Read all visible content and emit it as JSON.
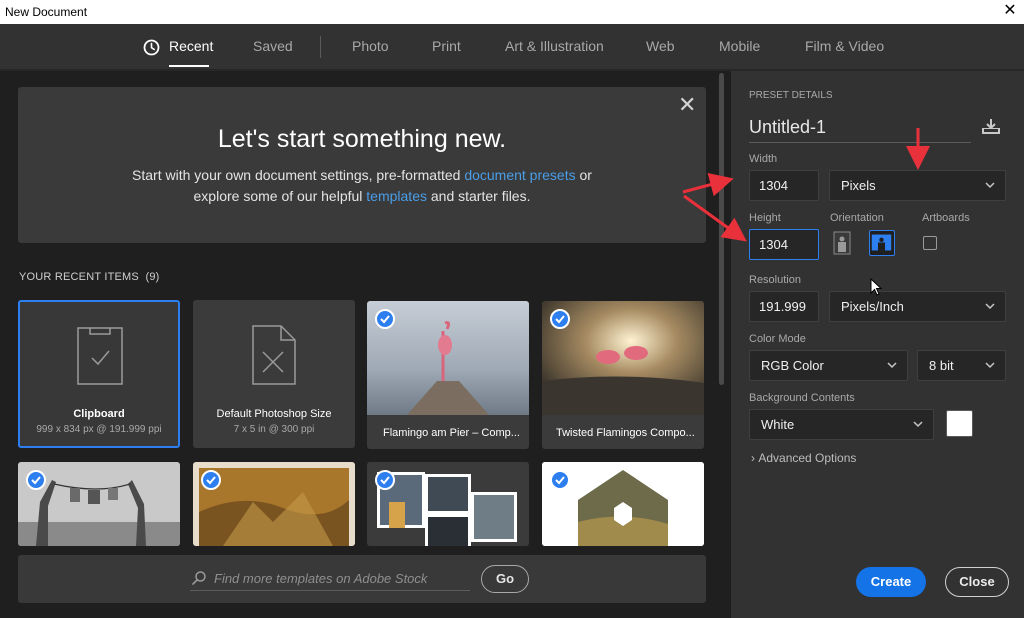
{
  "window": {
    "title": "New Document",
    "close_glyph": "✕"
  },
  "tabs": [
    {
      "label": "Recent",
      "active": true,
      "icon": "clock-icon"
    },
    {
      "label": "Saved"
    },
    {
      "label": "Photo"
    },
    {
      "label": "Print"
    },
    {
      "label": "Art & Illustration"
    },
    {
      "label": "Web"
    },
    {
      "label": "Mobile"
    },
    {
      "label": "Film & Video"
    }
  ],
  "welcome": {
    "heading": "Let's start something new.",
    "line1_pre": "Start with your own document settings, pre-formatted ",
    "line1_link": "document presets",
    "line1_post": " or",
    "line2_pre": "explore some of our helpful ",
    "line2_link": "templates",
    "line2_post": " and starter files.",
    "close_glyph": "✕"
  },
  "recent": {
    "header": "YOUR RECENT ITEMS",
    "count": "(9)",
    "items": [
      {
        "label": "Clipboard",
        "sub": "999 x 834 px @ 191.999 ppi",
        "selected": true,
        "icon": "clipboard-icon"
      },
      {
        "label": "Default Photoshop Size",
        "sub": "7 x 5 in @ 300 ppi",
        "icon": "document-ruler-icon"
      },
      {
        "label": "Flamingo am Pier – Comp...",
        "checked": true
      },
      {
        "label": "Twisted Flamingos Compo...",
        "checked": true
      },
      {
        "label": "",
        "checked": true
      },
      {
        "label": "",
        "checked": true
      },
      {
        "label": "",
        "checked": true
      },
      {
        "label": "",
        "checked": true
      }
    ]
  },
  "search": {
    "placeholder": "Find more templates on Adobe Stock",
    "go_label": "Go"
  },
  "preset": {
    "section_title": "PRESET DETAILS",
    "doc_name": "Untitled-1",
    "width_label": "Width",
    "width_value": "1304",
    "width_unit": "Pixels",
    "height_label": "Height",
    "height_value": "1304",
    "orientation_label": "Orientation",
    "artboards_label": "Artboards",
    "resolution_label": "Resolution",
    "resolution_value": "191.999",
    "resolution_unit": "Pixels/Inch",
    "color_mode_label": "Color Mode",
    "color_mode": "RGB Color",
    "bit_depth": "8 bit",
    "bg_label": "Background Contents",
    "bg_value": "White",
    "bg_swatch_color": "#ffffff",
    "advanced_label": "Advanced Options",
    "advanced_glyph": "›",
    "create_label": "Create",
    "close_label": "Close"
  },
  "colors": {
    "accent": "#2d7ff0",
    "create_button": "#1473e6",
    "annotation_arrows": "#e8313a"
  }
}
